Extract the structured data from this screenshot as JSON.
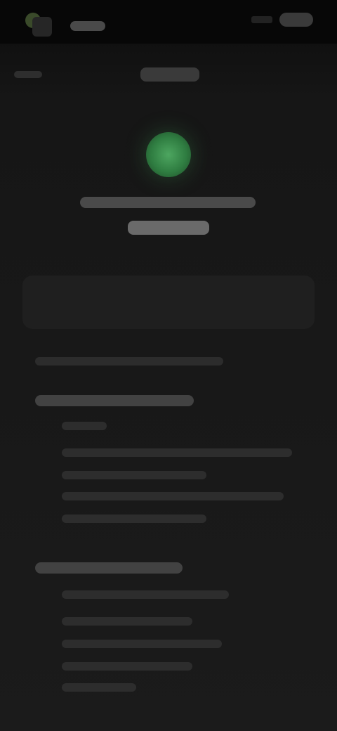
{
  "status_bar": {
    "left_icon": "circle-icon",
    "signal_icon": "signal-icon",
    "battery_icon": "battery-icon"
  },
  "header": {
    "back_icon": "back-chevron-icon",
    "title": ""
  },
  "hero": {
    "icon": "check-circle-icon",
    "accent_color": "#4da660",
    "headline": "",
    "subheadline": ""
  },
  "card": {
    "icon": "document-icon",
    "label": ""
  },
  "note": "",
  "section_one": {
    "title": "",
    "items": [
      "",
      "",
      "",
      "",
      "",
      ""
    ]
  },
  "section_two": {
    "title": "",
    "items": [
      "",
      "",
      "",
      "",
      ""
    ]
  }
}
